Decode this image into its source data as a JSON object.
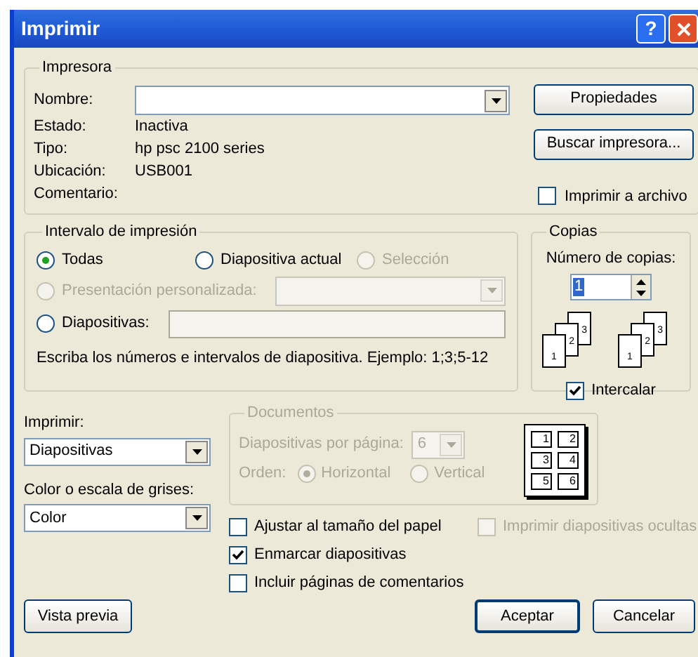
{
  "window": {
    "title": "Imprimir"
  },
  "title_buttons": [
    {
      "kind": "help",
      "label": "?"
    },
    {
      "kind": "close"
    }
  ],
  "printer": {
    "title": "Impresora",
    "name_label": "Nombre:",
    "fields": [
      {
        "label": "Estado:",
        "value": "Inactiva"
      },
      {
        "label": "Tipo:",
        "value": "hp psc 2100 series"
      },
      {
        "label": "Ubicación:",
        "value": "USB001"
      },
      {
        "label": "Comentario:"
      }
    ],
    "buttons": [
      "Propiedades",
      "Buscar impresora..."
    ],
    "print_to_file": {
      "label": "Imprimir a archivo",
      "checked": false
    }
  },
  "range": {
    "title": "Intervalo de impresión",
    "options": [
      {
        "label": "Todas",
        "selected": true,
        "disabled": false
      },
      {
        "label": "Diapositiva actual",
        "selected": false,
        "disabled": false
      },
      {
        "label": "Selección",
        "selected": false,
        "disabled": true
      },
      {
        "label": "Presentación personalizada:",
        "selected": false,
        "disabled": true
      },
      {
        "label": "Diapositivas:",
        "selected": false,
        "disabled": false
      }
    ],
    "hint": "Escriba los números e intervalos de diapositiva. Ejemplo: 1;3;5-12"
  },
  "copies": {
    "title": "Copias",
    "count_label": "Número de copias:",
    "count": "1",
    "stacks": [
      [
        "1",
        "2",
        "3"
      ],
      [
        "1",
        "2",
        "3"
      ]
    ],
    "collate": {
      "label": "Intercalar",
      "checked": true
    }
  },
  "print_what": {
    "label": "Imprimir:",
    "value": "Diapositivas"
  },
  "color_mode": {
    "label": "Color o escala de grises:",
    "value": "Color"
  },
  "handouts": {
    "title": "Documentos",
    "disabled": true,
    "per_page_label": "Diapositivas por página:",
    "per_page": "6",
    "order_label": "Orden:",
    "orders": [
      {
        "label": "Horizontal",
        "selected": true
      },
      {
        "label": "Vertical",
        "selected": false
      }
    ],
    "preview": [
      "1",
      "2",
      "3",
      "4",
      "5",
      "6"
    ]
  },
  "options": [
    {
      "label": "Ajustar al tamaño del papel",
      "checked": false,
      "disabled": false
    },
    {
      "label": "Imprimir diapositivas ocultas",
      "checked": false,
      "disabled": true
    },
    {
      "label": "Enmarcar diapositivas",
      "checked": true,
      "disabled": false
    },
    {
      "label": "Incluir páginas de comentarios",
      "checked": false,
      "disabled": false
    }
  ],
  "footer_buttons": [
    {
      "label": "Vista previa",
      "default": false
    },
    {
      "label": "Aceptar",
      "default": true
    },
    {
      "label": "Cancelar",
      "default": false
    }
  ]
}
